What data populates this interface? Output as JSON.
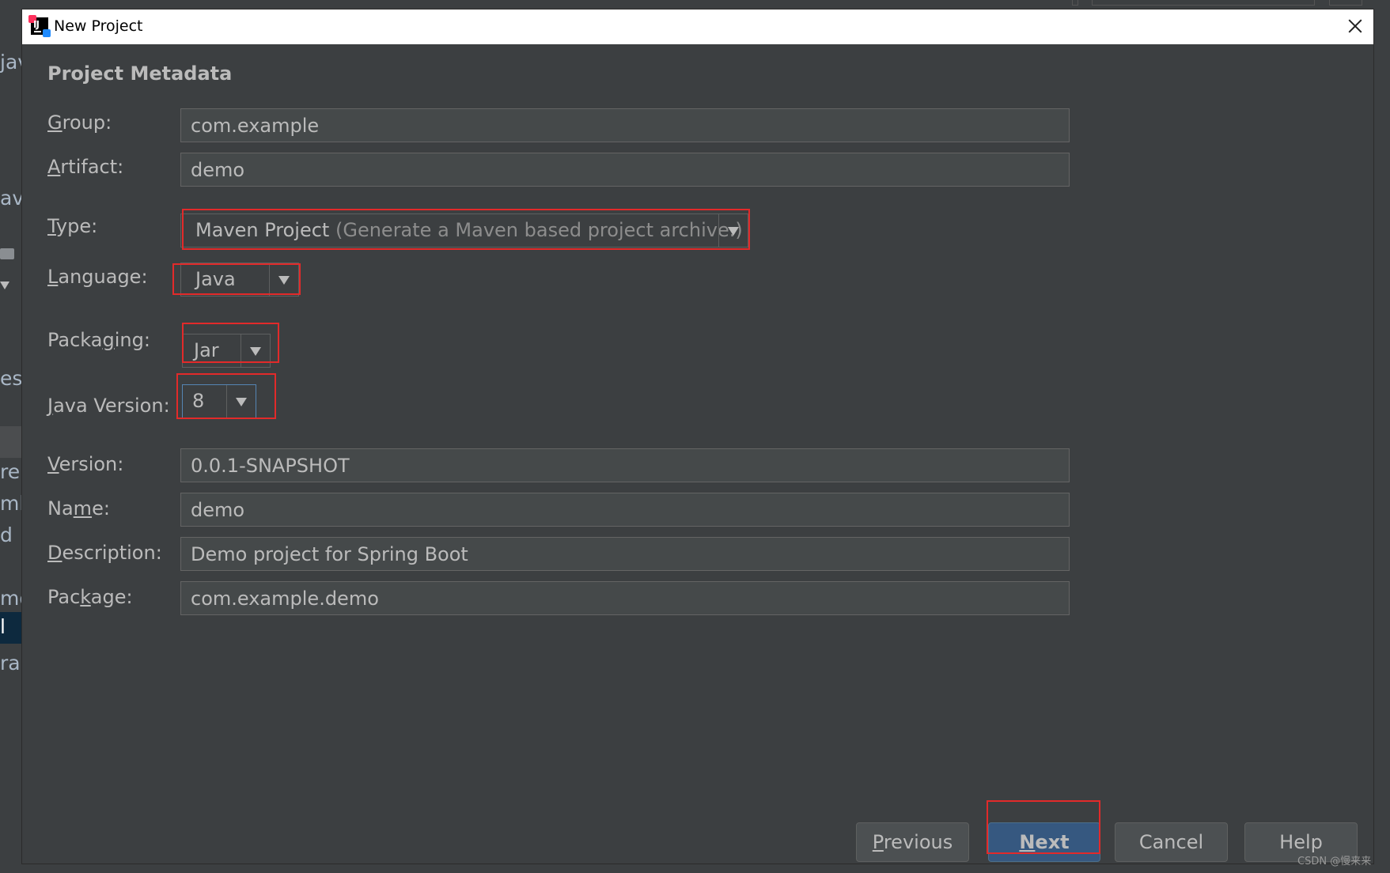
{
  "ide_bg": {
    "fragments": [
      "jav",
      "ava",
      "esc",
      "re",
      "ml",
      "d",
      "md",
      "l",
      "rar"
    ]
  },
  "dialog": {
    "title": "New Project",
    "section_title": "Project Metadata",
    "fields": {
      "group": {
        "label_pre": "",
        "label_key": "G",
        "label_post": "roup:",
        "value": "com.example"
      },
      "artifact": {
        "label_pre": "",
        "label_key": "A",
        "label_post": "rtifact:",
        "value": "demo"
      },
      "type": {
        "label_pre": "",
        "label_key": "T",
        "label_post": "ype:",
        "value_main": "Maven Project",
        "value_muted": "(Generate a Maven based project archive.)"
      },
      "language": {
        "label_pre": "",
        "label_key": "L",
        "label_post": "anguage:",
        "value": "Java"
      },
      "packaging": {
        "label_pre": "Packa",
        "label_key": "g",
        "label_post": "ing:",
        "value": "Jar"
      },
      "java_version": {
        "label_pre": "",
        "label_key": "J",
        "label_post": "ava Version:",
        "value": "8"
      },
      "version": {
        "label_pre": "",
        "label_key": "V",
        "label_post": "ersion:",
        "value": "0.0.1-SNAPSHOT"
      },
      "name": {
        "label_pre": "Na",
        "label_key": "m",
        "label_post": "e:",
        "value": "demo"
      },
      "description": {
        "label_pre": "",
        "label_key": "D",
        "label_post": "escription:",
        "value": "Demo project for Spring Boot"
      },
      "package": {
        "label_pre": "Pac",
        "label_key": "k",
        "label_post": "age:",
        "value": "com.example.demo"
      }
    },
    "buttons": {
      "previous": {
        "key": "P",
        "rest": "revious"
      },
      "next": {
        "key": "N",
        "rest": "ext"
      },
      "cancel": "Cancel",
      "help": "Help"
    }
  },
  "watermark": "CSDN @慢来来",
  "colors": {
    "dialog_bg": "#3c3f41",
    "field_bg": "#45494a",
    "highlight_red": "#e22a2a",
    "primary_button": "#365880"
  }
}
